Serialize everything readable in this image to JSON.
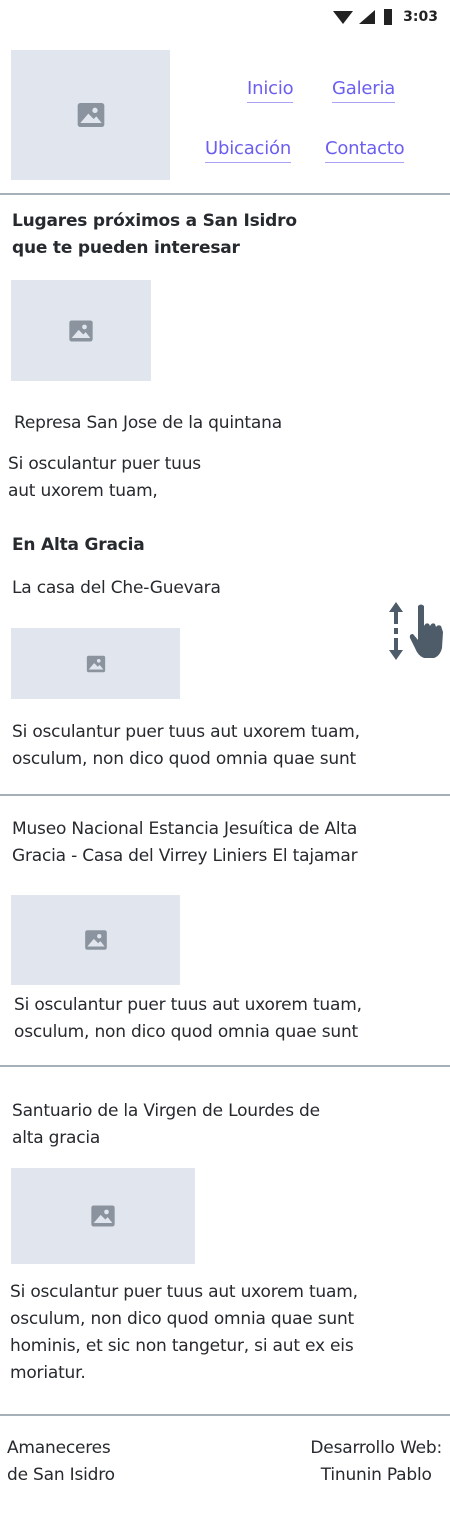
{
  "status_bar": {
    "time": "3:03",
    "wifi_icon": "wifi-icon",
    "signal_icon": "signal-icon",
    "battery_icon": "battery-icon"
  },
  "header": {
    "logo_icon": "image-placeholder-icon",
    "nav": [
      {
        "label": "Inicio"
      },
      {
        "label": "Galeria"
      },
      {
        "label": "Ubicación"
      },
      {
        "label": "Contacto"
      }
    ]
  },
  "section": {
    "title_line1": "Lugares próximos a San Isidro",
    "title_line2": "que te pueden interesar"
  },
  "place1": {
    "name": "Represa San Jose de la quintana",
    "desc_line1": "Si osculantur puer tuus",
    "desc_line2": "aut uxorem tuam,"
  },
  "subheading": "En Alta Gracia",
  "place2": {
    "name": "La casa del Che-Guevara",
    "desc_line1": "Si osculantur puer tuus aut uxorem tuam,",
    "desc_line2": "osculum, non dico quod omnia quae sunt",
    "scroll_hint_icon": "scroll-gesture-icon"
  },
  "place3": {
    "name_line1": "Museo Nacional Estancia Jesuítica de Alta",
    "name_line2": "Gracia - Casa del Virrey Liniers El tajamar",
    "desc_line1": "Si osculantur puer tuus aut uxorem tuam,",
    "desc_line2": "osculum, non dico quod omnia quae sunt"
  },
  "place4": {
    "name_line1": "Santuario de la Virgen de Lourdes de",
    "name_line2": "alta gracia",
    "desc_line1": "Si osculantur puer tuus aut uxorem tuam,",
    "desc_line2": "osculum, non dico quod omnia quae sunt",
    "desc_line3": "hominis, et sic non tangetur, si aut ex eis",
    "desc_line4": "moriatur."
  },
  "footer": {
    "left_line1": "Amaneceres",
    "left_line2": "de San Isidro",
    "right_line1": "Desarrollo Web:",
    "right_line2": "Tinunin Pablo"
  },
  "colors": {
    "link": "#6b5ef0",
    "placeholder_bg": "#e1e6ee",
    "placeholder_icon": "#8b949e",
    "divider": "#a6b0b9"
  }
}
